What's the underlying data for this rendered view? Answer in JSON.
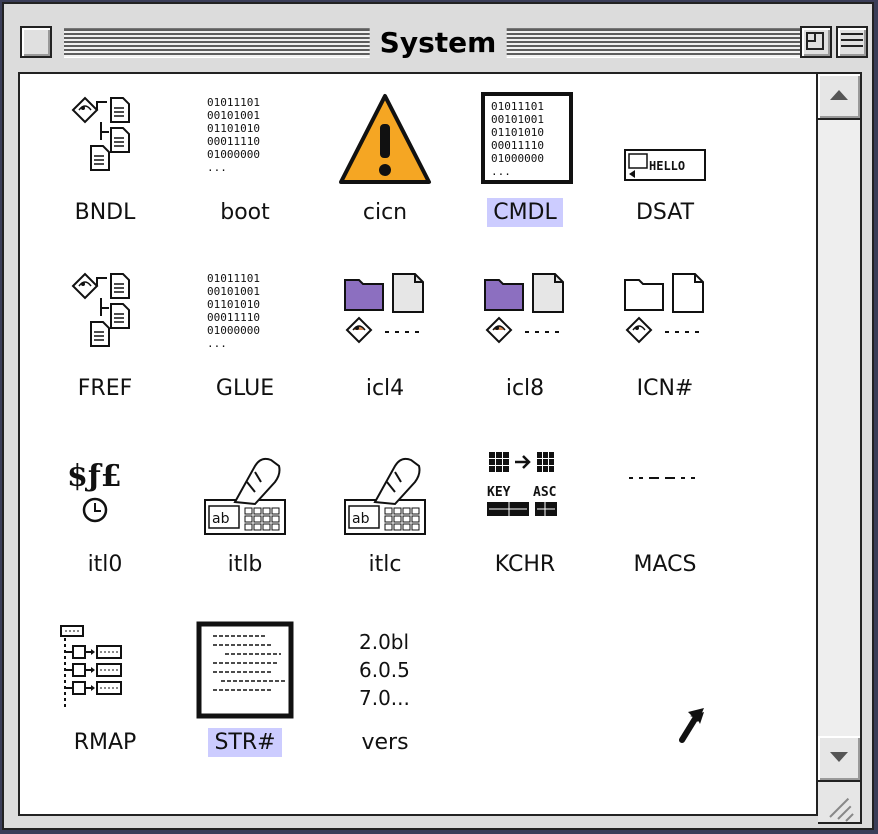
{
  "window": {
    "title": "System"
  },
  "icons": [
    {
      "label": "BNDL",
      "kind": "bndl"
    },
    {
      "label": "boot",
      "kind": "binary",
      "lines": [
        "01011101",
        "00101001",
        "01101010",
        "00011110",
        "01000000",
        "..."
      ]
    },
    {
      "label": "cicn",
      "kind": "warning"
    },
    {
      "label": "CMDL",
      "kind": "binary-selected",
      "selected": true,
      "lines": [
        "01011101",
        "00101001",
        "01101010",
        "00011110",
        "01000000",
        "..."
      ]
    },
    {
      "label": "DSAT",
      "kind": "hello",
      "text": "HELLO"
    },
    {
      "label": "FREF",
      "kind": "bndl"
    },
    {
      "label": "GLUE",
      "kind": "binary",
      "lines": [
        "01011101",
        "00101001",
        "01101010",
        "00011110",
        "01000000",
        "..."
      ]
    },
    {
      "label": "icl4",
      "kind": "folder-doc-color"
    },
    {
      "label": "icl8",
      "kind": "folder-doc-color"
    },
    {
      "label": "ICN#",
      "kind": "folder-doc-bw"
    },
    {
      "label": "itl0",
      "kind": "currency",
      "text": "$ƒ£"
    },
    {
      "label": "itlb",
      "kind": "keyboard-hand",
      "text": "ab"
    },
    {
      "label": "itlc",
      "kind": "keyboard-hand",
      "text": "ab"
    },
    {
      "label": "KCHR",
      "kind": "kchr",
      "key": "KEY",
      "asc": "ASC"
    },
    {
      "label": "MACS",
      "kind": "dashes"
    },
    {
      "label": "RMAP",
      "kind": "rmap"
    },
    {
      "label": "STR#",
      "kind": "str",
      "selected": true
    },
    {
      "label": "vers",
      "kind": "vers",
      "lines": [
        "2.0bl",
        "6.0.5",
        "7.0..."
      ]
    }
  ],
  "colors": {
    "selection": "#ccccff",
    "warning_fill": "#f5a623",
    "folder_color": "#8c6fc0",
    "desktop": "#3b3e58"
  }
}
